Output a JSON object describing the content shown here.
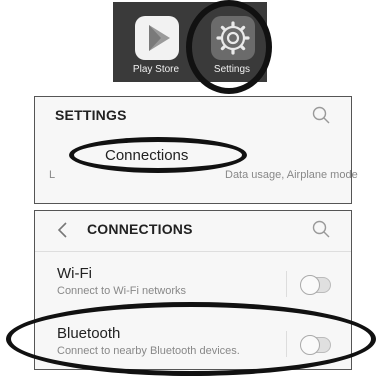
{
  "launcher": {
    "apps": [
      {
        "label": "Play Store",
        "icon": "play-store-icon"
      },
      {
        "label": "Settings",
        "icon": "gear-icon"
      }
    ]
  },
  "settings_panel": {
    "title": "SETTINGS",
    "item": {
      "title": "Connections",
      "subtitle_visible": "Data usage, Airplane mode"
    }
  },
  "connections_panel": {
    "title": "CONNECTIONS",
    "rows": [
      {
        "title": "Wi-Fi",
        "subtitle": "Connect to Wi-Fi networks",
        "toggle_on": false
      },
      {
        "title": "Bluetooth",
        "subtitle": "Connect to nearby Bluetooth devices.",
        "toggle_on": false
      }
    ]
  },
  "colors": {
    "launcher_bg": "#3a3a3a",
    "panel_bg": "#f7f7f7",
    "highlight_ring": "#111111"
  }
}
